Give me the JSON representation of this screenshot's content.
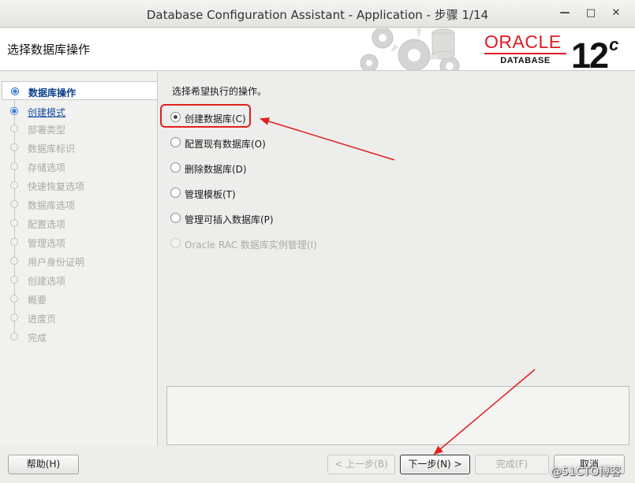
{
  "window": {
    "title": "Database Configuration Assistant - Application - 步骤 1/14",
    "minimize_glyph": "—",
    "maximize_glyph": "□",
    "close_glyph": "✕"
  },
  "header": {
    "page_title": "选择数据库操作",
    "brand": "ORACLE",
    "brand_sub": "DATABASE",
    "version": "12",
    "version_suffix": "c"
  },
  "nav": {
    "items": [
      {
        "label": "数据库操作",
        "state": "current"
      },
      {
        "label": "创建模式",
        "state": "next"
      },
      {
        "label": "部署类型",
        "state": "disabled"
      },
      {
        "label": "数据库标识",
        "state": "disabled"
      },
      {
        "label": "存储选项",
        "state": "disabled"
      },
      {
        "label": "快速恢复选项",
        "state": "disabled"
      },
      {
        "label": "数据库选项",
        "state": "disabled"
      },
      {
        "label": "配置选项",
        "state": "disabled"
      },
      {
        "label": "管理选项",
        "state": "disabled"
      },
      {
        "label": "用户身份证明",
        "state": "disabled"
      },
      {
        "label": "创建选项",
        "state": "disabled"
      },
      {
        "label": "概要",
        "state": "disabled"
      },
      {
        "label": "进度页",
        "state": "disabled"
      },
      {
        "label": "完成",
        "state": "disabled"
      }
    ]
  },
  "main": {
    "prompt": "选择希望执行的操作。",
    "options": [
      {
        "label": "创建数据库(C)",
        "selected": true,
        "enabled": true
      },
      {
        "label": "配置现有数据库(O)",
        "selected": false,
        "enabled": true
      },
      {
        "label": "删除数据库(D)",
        "selected": false,
        "enabled": true
      },
      {
        "label": "管理模板(T)",
        "selected": false,
        "enabled": true
      },
      {
        "label": "管理可插入数据库(P)",
        "selected": false,
        "enabled": true
      },
      {
        "label": "Oracle RAC 数据库实例管理(I)",
        "selected": false,
        "enabled": false
      }
    ]
  },
  "buttons": {
    "help": "帮助(H)",
    "back": "< 上一步(B)",
    "next": "下一步(N) >",
    "finish": "完成(F)",
    "cancel": "取消"
  },
  "watermark": "@51CTO博客",
  "colors": {
    "annotation_red": "#e02020",
    "oracle_red": "#e11b22",
    "nav_current": "#0c3f8d",
    "radio_accent": "#1d64b8"
  }
}
